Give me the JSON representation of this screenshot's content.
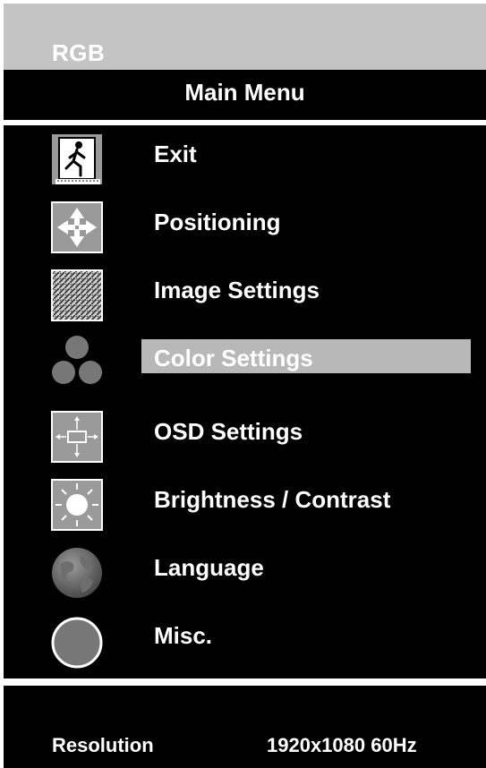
{
  "header": {
    "source": "RGB",
    "title": "Main Menu"
  },
  "menu": {
    "selected_index": 3,
    "items": [
      {
        "label": "Exit",
        "icon": "exit-icon"
      },
      {
        "label": "Positioning",
        "icon": "positioning-arrows-icon"
      },
      {
        "label": "Image Settings",
        "icon": "image-pattern-icon"
      },
      {
        "label": "Color Settings",
        "icon": "color-circles-icon"
      },
      {
        "label": "OSD Settings",
        "icon": "osd-position-icon"
      },
      {
        "label": "Brightness / Contrast",
        "icon": "sun-icon"
      },
      {
        "label": "Language",
        "icon": "globe-icon"
      },
      {
        "label": "Misc.",
        "icon": "misc-circle-icon"
      }
    ]
  },
  "footer": {
    "resolution_label": "Resolution",
    "resolution_value": "1920x1080 60Hz"
  },
  "colors": {
    "background": "#000000",
    "header_bar": "#c4c4c4",
    "highlight": "#b8b8b8",
    "text": "#ffffff"
  }
}
